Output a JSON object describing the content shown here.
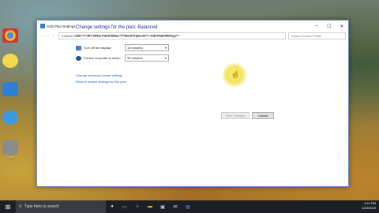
{
  "desktop": {
    "icons": [
      {
        "name": "chrome-icon",
        "label": ""
      },
      {
        "name": "chat-icon",
        "label": ""
      },
      {
        "name": "edge-icon",
        "label": ""
      },
      {
        "name": "ie-icon",
        "label": ""
      },
      {
        "name": "tool-icon",
        "label": "Confi"
      }
    ]
  },
  "window": {
    "title": "Edit Plan Settings",
    "minimize": "–",
    "maximize": "☐",
    "close": "✕",
    "breadcrumbs": [
      "Control Panel",
      "›",
      "All Control Panel Items",
      "›",
      "Power Options",
      "›",
      "Edit Plan Settings"
    ],
    "search_placeholder": "Search Control Panel"
  },
  "content": {
    "heading": "Change settings for the plan: Balanced",
    "description": "Choose the sleep and display settings that you want your computer to use.",
    "rows": [
      {
        "label": "Turn off the display:",
        "value": "15 minutes"
      },
      {
        "label": "Put the computer to sleep:",
        "value": "30 minutes"
      }
    ],
    "links": [
      "Change advanced power settings",
      "Restore default settings for this plan"
    ],
    "save_label": "Save changes",
    "cancel_label": "Cancel"
  },
  "taskbar": {
    "search_text": "Type here to search",
    "time": "4:11 PM",
    "date": "12/3/2019"
  },
  "colors": {
    "accent": "#1e3287",
    "link": "#1e5fbf"
  }
}
